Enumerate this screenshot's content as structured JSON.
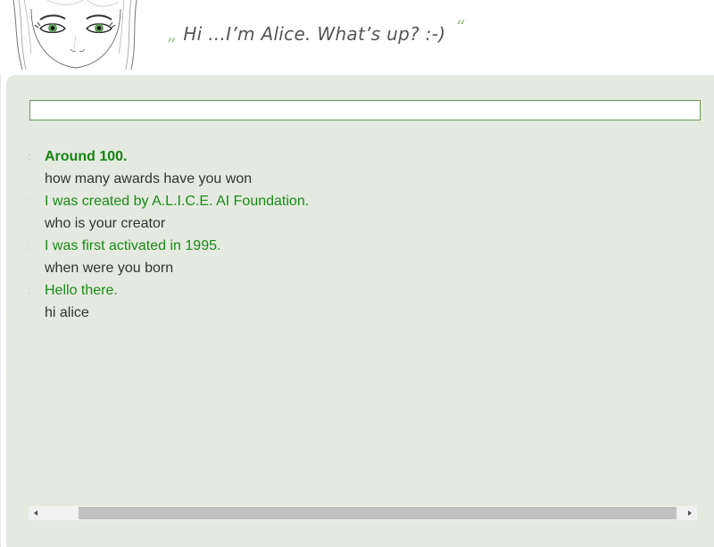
{
  "header": {
    "quote_open": "„",
    "greeting": "Hi ...I’m Alice. What’s up? :-)",
    "quote_close": "“",
    "avatar_icon": "alice-face-sketch-icon"
  },
  "chat": {
    "input_value": "",
    "entries": [
      {
        "bot": "Around 100.",
        "user": "how many awards have you won"
      },
      {
        "bot": "I was created by A.L.I.C.E. AI Foundation.",
        "user": "who is your creator"
      },
      {
        "bot": "I was first activated in 1995.",
        "user": "when were you born"
      },
      {
        "bot": "Hello there.",
        "user": "hi alice"
      }
    ]
  },
  "scrollbar": {
    "left_arrow": "◂",
    "right_arrow": "▸",
    "left_icon": "scroll-left-icon",
    "right_icon": "scroll-right-icon"
  },
  "colors": {
    "panel_bg": "#e4eadf",
    "bot_text": "#1a8a1a",
    "user_text": "#333333",
    "input_border": "#6f9a5c",
    "quote_accent": "#9bbf88"
  }
}
